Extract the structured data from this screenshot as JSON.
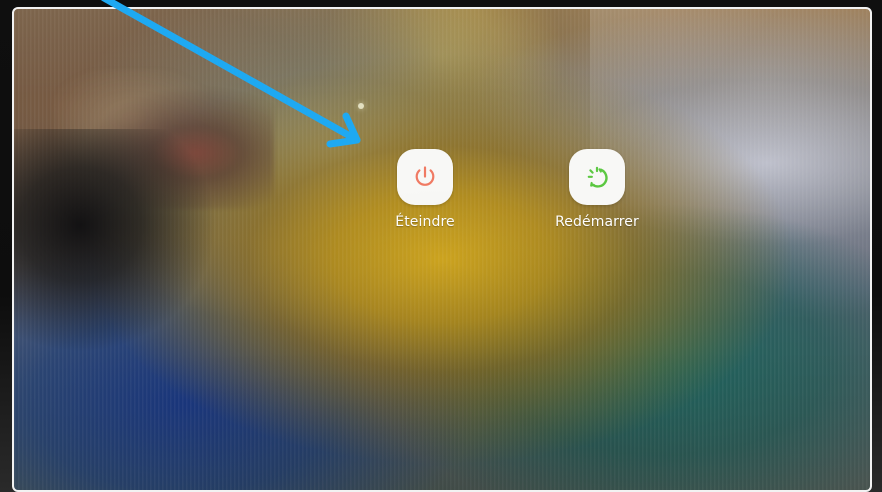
{
  "screen": {
    "actions": [
      {
        "id": "shutdown",
        "label": "Éteindre",
        "icon": "power-icon",
        "icon_color": "#f07a63"
      },
      {
        "id": "restart",
        "label": "Redémarrer",
        "icon": "restart-icon",
        "icon_color": "#56c63b"
      }
    ]
  },
  "annotation": {
    "arrow_color": "#1ea9f2"
  }
}
